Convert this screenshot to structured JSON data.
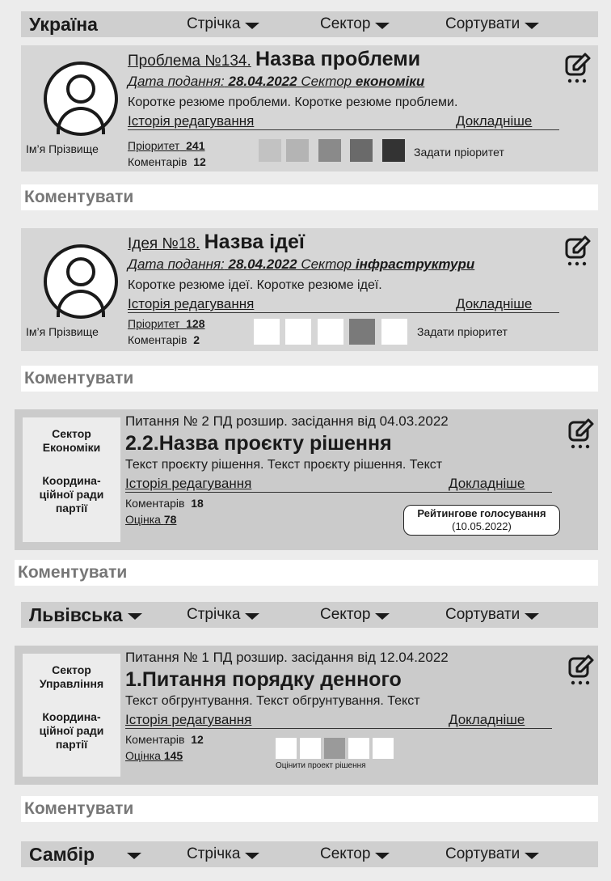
{
  "region_bars": [
    {
      "region": "Україна",
      "region_dropdown": false,
      "tabs": [
        "Стрічка",
        "Сектор",
        "Сортувати"
      ]
    },
    {
      "region": "Львівська",
      "region_dropdown": true,
      "tabs": [
        "Стрічка",
        "Сектор",
        "Сортувати"
      ]
    },
    {
      "region": "Самбір",
      "region_dropdown": true,
      "tabs": [
        "Стрічка",
        "Сектор",
        "Сортувати"
      ]
    }
  ],
  "comment_label": "Коментувати",
  "problem": {
    "number": "Проблема №134.",
    "title": "Назва проблеми",
    "date_label": "Дата подання:",
    "date": "28.04.2022",
    "sector_label": "Сектор",
    "sector": "економіки",
    "summary": "Коротке резюме проблеми. Коротке резюме проблеми.",
    "history": "Історія редагування",
    "more": "Докладніше",
    "author": "Ім’я Прізвище",
    "priority_label": "Пріоритет",
    "priority": "241",
    "comments_label": "Коментарів",
    "comments": "12",
    "set_priority": "Задати пріоритет",
    "priority_scale_colors": [
      "#c2c2c2",
      "#b4b4b4",
      "#8a8a8a",
      "#6a6a6a",
      "#333333"
    ]
  },
  "idea": {
    "number": "Ідея №18.",
    "title": "Назва ідеї",
    "date_label": "Дата подання:",
    "date": "28.04.2022",
    "sector_label": "Сектор",
    "sector": "інфраструктури",
    "summary": "Коротке резюме ідеї. Коротке резюме ідеї.",
    "history": "Історія редагування",
    "more": "Докладніше",
    "author": "Ім’я Прізвище",
    "priority_label": "Пріоритет",
    "priority": "128",
    "comments_label": "Коментарів",
    "comments": "2",
    "set_priority": "Задати пріоритет",
    "priority_scale_colors": [
      "#ffffff",
      "#ffffff",
      "#ffffff",
      "#7a7a7a",
      "#ffffff"
    ]
  },
  "decision": {
    "sector_line1": "Сектор",
    "sector_line2": "Економіки",
    "council_line1": "Координа-",
    "council_line2": "ційної ради",
    "council_line3": "партії",
    "meeting": "Питання № 2 ПД розшир. засідання від 04.03.2022",
    "title": "2.2.Назва проєкту рішення",
    "text": "Текст проєкту рішення. Текст проєкту рішення.  Текст",
    "history": "Історія редагування",
    "more": "Докладніше",
    "comments_label": "Коментарів",
    "comments": "18",
    "rating_label": "Оцінка",
    "rating": "78",
    "vote_title": "Рейтингове голосування",
    "vote_date": "(10.05.2022)"
  },
  "agenda": {
    "sector_line1": "Сектор",
    "sector_line2": "Управління",
    "council_line1": "Координа-",
    "council_line2": "ційної ради",
    "council_line3": "партії",
    "meeting": "Питання № 1 ПД розшир. засідання від 12.04.2022",
    "title": "1.Питання порядку денного",
    "text": "Текст обгрунтування. Текст обгрунтування.  Текст",
    "history": "Історія редагування",
    "more": "Докладніше",
    "comments_label": "Коментарів",
    "comments": "12",
    "rating_label": "Оцінка",
    "rating": "145",
    "rate_label": "Оцінити проект рішення",
    "rate_scale_colors": [
      "#ffffff",
      "#ffffff",
      "#9a9a9a",
      "#ffffff",
      "#ffffff"
    ]
  }
}
